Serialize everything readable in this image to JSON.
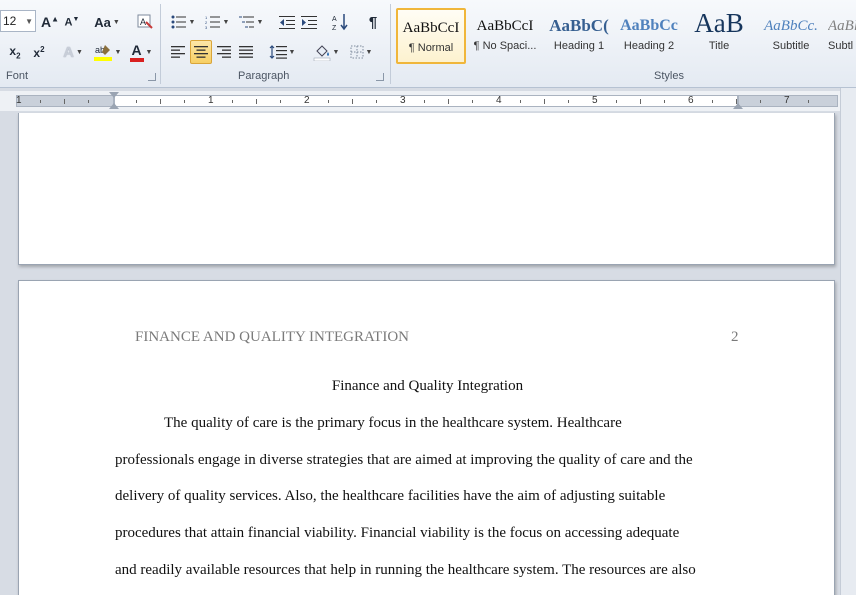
{
  "ribbon": {
    "font_size": "12",
    "font_group_label": "Font",
    "paragraph_group_label": "Paragraph",
    "styles_group_label": "Styles",
    "change_case_label": "Aa",
    "font_color_letter": "A",
    "font_color_hex": "#d92020",
    "highlight_color_hex": "#ffff00",
    "styles": [
      {
        "sample": "AaBbCcI",
        "name": "¶ Normal"
      },
      {
        "sample": "AaBbCcI",
        "name": "¶ No Spaci..."
      },
      {
        "sample": "AaBbC(",
        "name": "Heading 1"
      },
      {
        "sample": "AaBbCc",
        "name": "Heading 2"
      },
      {
        "sample": "AaB",
        "name": "Title"
      },
      {
        "sample": "AaBbCc.",
        "name": "Subtitle"
      },
      {
        "sample": "AaBl",
        "name": "Subtl"
      }
    ]
  },
  "ruler": {
    "numbers": [
      "1",
      "1",
      "2",
      "3",
      "4",
      "5",
      "6",
      "7"
    ]
  },
  "document": {
    "running_header": "FINANCE AND QUALITY INTEGRATION",
    "page_number": "2",
    "title": "Finance and Quality Integration",
    "lines": [
      "The quality of care is the primary focus in the healthcare system. Healthcare",
      "professionals engage in diverse strategies that are aimed at improving the quality of care and the",
      "delivery of quality services.  Also, the healthcare facilities have the aim of adjusting suitable",
      "procedures that attain financial viability. Financial viability is the focus on accessing adequate",
      "and readily available resources that help in running the healthcare system. The resources  are also"
    ]
  }
}
